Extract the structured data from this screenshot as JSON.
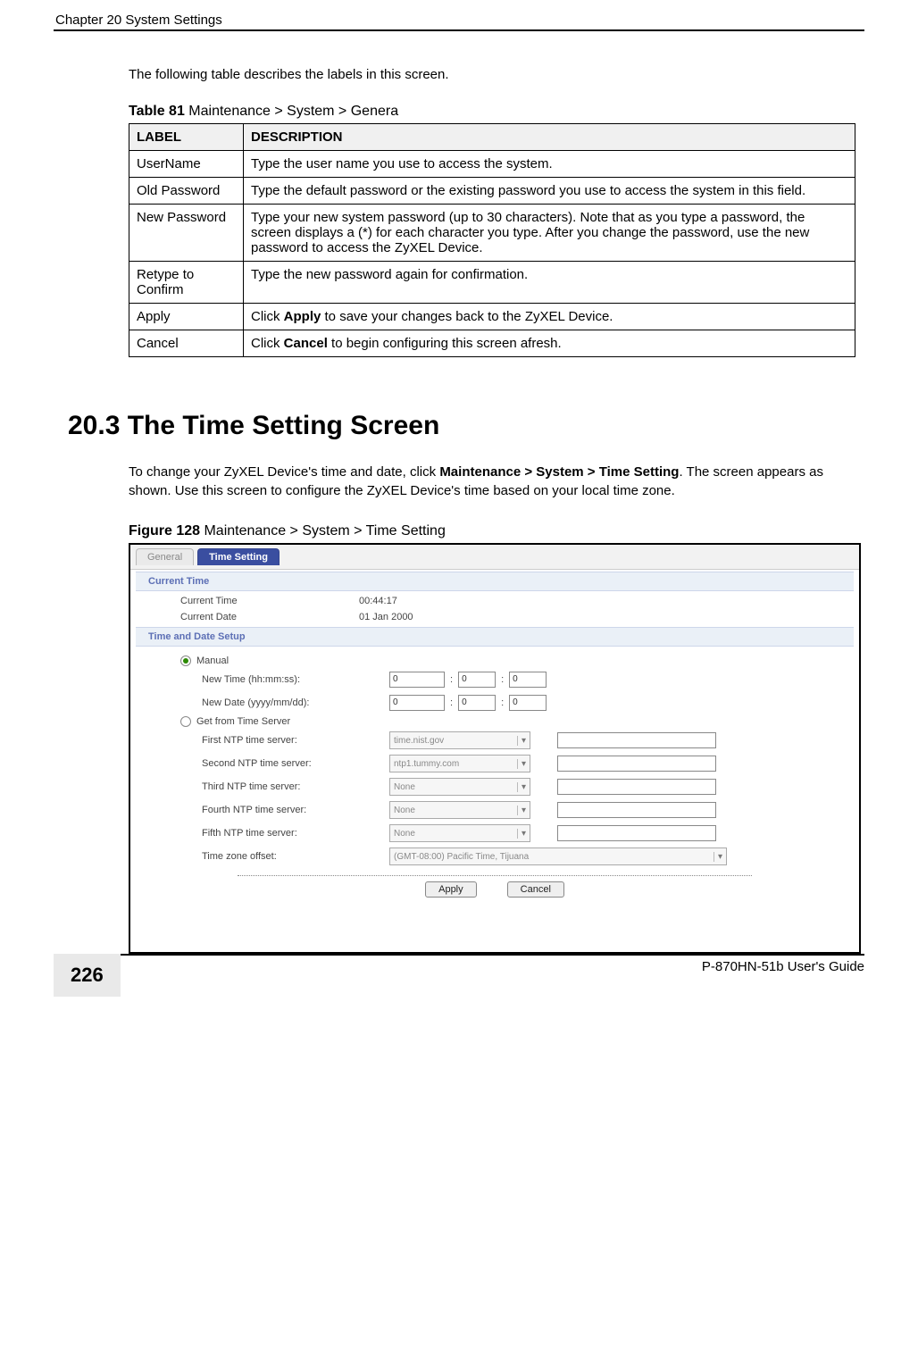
{
  "header": {
    "chapter": "Chapter 20 System Settings"
  },
  "intro": "The following table describes the labels in this screen.",
  "table81": {
    "caption_bold": "Table 81",
    "caption_rest": "   Maintenance > System > Genera",
    "head_label": "LABEL",
    "head_desc": "DESCRIPTION",
    "rows": [
      {
        "label": "UserName",
        "desc": "Type the user name you use to access the system."
      },
      {
        "label": "Old Password",
        "desc": "Type the default password or the existing password you use to access the system in this field."
      },
      {
        "label": "New Password",
        "desc": "Type your new system password (up to 30 characters). Note that as you type a password, the screen displays a (*) for each character you type. After you change the password, use the new password to access the ZyXEL Device."
      },
      {
        "label": "Retype to Confirm",
        "desc": "Type the new password again for confirmation."
      },
      {
        "label": "Apply",
        "desc_pre": "Click ",
        "desc_b": "Apply",
        "desc_post": " to save your changes back to the ZyXEL Device."
      },
      {
        "label": "Cancel",
        "desc_pre": "Click ",
        "desc_b": "Cancel",
        "desc_post": " to begin configuring this screen afresh."
      }
    ]
  },
  "section": {
    "heading": "20.3  The Time Setting Screen",
    "para_pre": "To change your ZyXEL Device's time and date, click ",
    "para_b": "Maintenance > System > Time Setting",
    "para_post": ". The screen appears as shown. Use this screen to configure the ZyXEL Device's time based on your local time zone."
  },
  "figure128": {
    "caption_bold": "Figure 128",
    "caption_rest": "   Maintenance > System > Time Setting",
    "tabs": {
      "general": "General",
      "time": "Time Setting"
    },
    "band_current": "Current Time",
    "current": {
      "time_lbl": "Current Time",
      "time_val": "00:44:17",
      "date_lbl": "Current Date",
      "date_val": "01 Jan 2000"
    },
    "band_setup": "Time and Date Setup",
    "radio_manual": "Manual",
    "newtime_lbl": "New Time (hh:mm:ss):",
    "newdate_lbl": "New Date (yyyy/mm/dd):",
    "vals": {
      "h": "0",
      "m": "0",
      "s": "0",
      "y": "0",
      "mo": "0",
      "d": "0"
    },
    "radio_server": "Get from Time Server",
    "ntp1_lbl": "First NTP time server:",
    "ntp2_lbl": "Second NTP time server:",
    "ntp3_lbl": "Third NTP time server:",
    "ntp4_lbl": "Fourth NTP time server:",
    "ntp5_lbl": "Fifth NTP time server:",
    "tz_lbl": "Time zone offset:",
    "ntp1_val": "time.nist.gov",
    "ntp2_val": "ntp1.tummy.com",
    "none_val": "None",
    "tz_val": "(GMT-08:00) Pacific Time, Tijuana",
    "apply_btn": "Apply",
    "cancel_btn": "Cancel"
  },
  "footer": {
    "page": "226",
    "guide": "P-870HN-51b User's Guide"
  }
}
